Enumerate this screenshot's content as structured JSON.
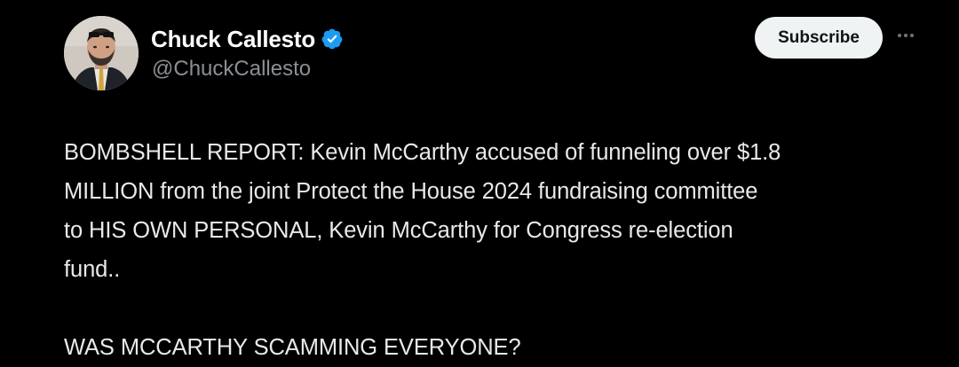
{
  "post": {
    "author": {
      "display_name": "Chuck Callesto",
      "handle": "@ChuckCallesto",
      "verified": true,
      "verified_color": "#1d9bf0",
      "avatar_icon": "profile-photo"
    },
    "subscribe_label": "Subscribe",
    "more_icon": "ellipsis-icon",
    "text": {
      "paragraph_1_lines": [
        "BOMBSHELL REPORT: Kevin McCarthy accused of funneling over $1.8",
        "MILLION from the joint Protect the House 2024 fundraising committee",
        "to HIS OWN PERSONAL, Kevin McCarthy for Congress re-election",
        "fund.."
      ],
      "paragraph_2": "WAS MCCARTHY SCAMMING EVERYONE?"
    }
  },
  "theme": {
    "background": "#000000",
    "text_primary": "#e7e9ea",
    "text_secondary": "#8b8f94",
    "button_bg": "#eff3f4",
    "button_text": "#0f1419"
  }
}
